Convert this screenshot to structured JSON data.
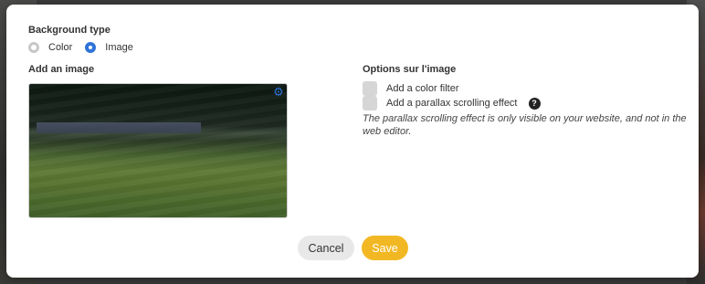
{
  "dialog": {
    "background_type": {
      "title": "Background type",
      "options": [
        {
          "label": "Color",
          "selected": false
        },
        {
          "label": "Image",
          "selected": true
        }
      ]
    },
    "image": {
      "title": "Add an image",
      "settings_icon": "gear-icon"
    },
    "image_options": {
      "title": "Options sur l'image",
      "color_filter_label": "Add a color filter",
      "color_filter_checked": false,
      "parallax_label": "Add a parallax scrolling effect",
      "parallax_checked": false,
      "help_icon": "question-mark-icon",
      "parallax_note": "The parallax scrolling effect is only visible on your website, and not in the web editor."
    },
    "buttons": {
      "cancel_label": "Cancel",
      "save_label": "Save"
    },
    "colors": {
      "accent_blue": "#2f73d8",
      "save_yellow": "#f2b824",
      "cancel_gray": "#e8e8e8",
      "checkbox_gray": "#d6d6d6"
    }
  }
}
